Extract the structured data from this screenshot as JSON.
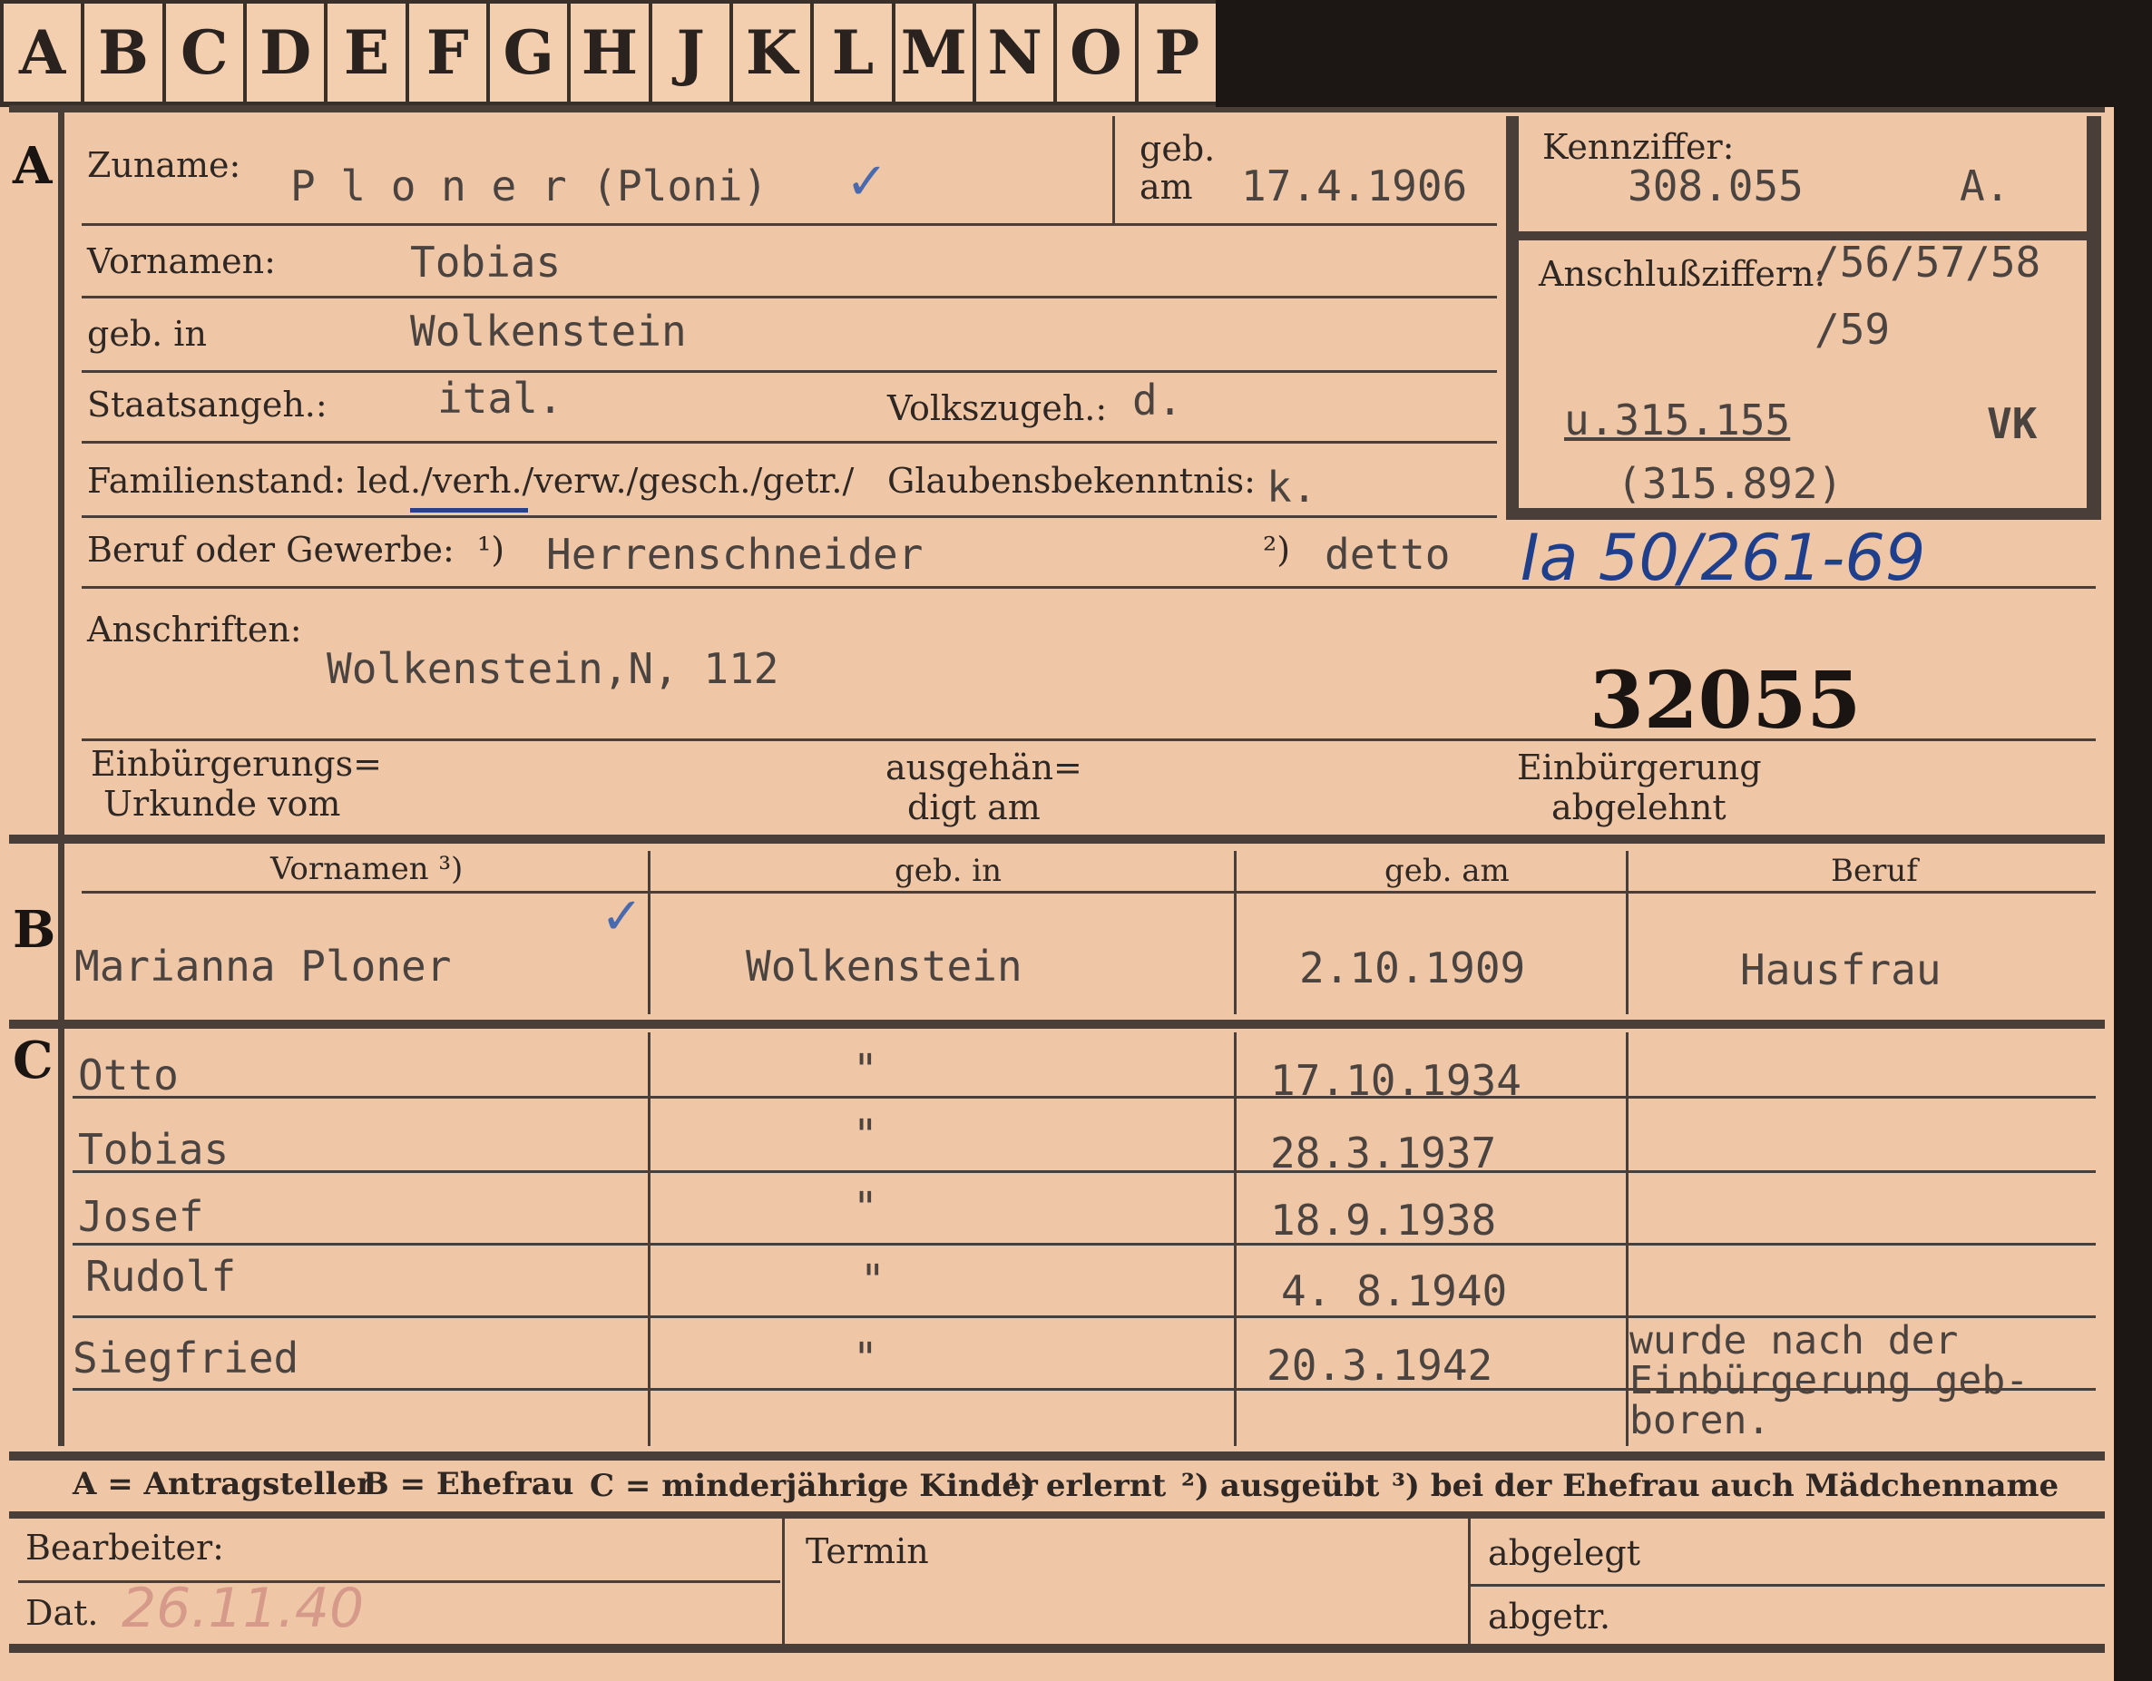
{
  "tabs": [
    "A",
    "B",
    "C",
    "D",
    "E",
    "F",
    "G",
    "H",
    "J",
    "K",
    "L",
    "M",
    "N",
    "O",
    "P"
  ],
  "sections": {
    "a": "A",
    "b": "B",
    "c": "C"
  },
  "form": {
    "zuname_label": "Zuname:",
    "zuname_value": "P l o n e r  (Ploni)",
    "geb_am_label1": "geb.",
    "geb_am_label2": "am",
    "geb_am_value": "17.4.1906",
    "kennziffer_label": "Kennziffer:",
    "kennziffer_value": "308.055",
    "kennziffer_suffix": "A.",
    "anschluss_label": "Anschlußziffern:",
    "anschluss_value1": "/56/57/58",
    "anschluss_value2": "/59",
    "u_value": "u.315.155",
    "vk": "VK",
    "u_value2": "(315.892)",
    "vornamen_label": "Vornamen:",
    "vornamen_value": "Tobias",
    "geb_in_label": "geb. in",
    "geb_in_value": "Wolkenstein",
    "staat_label": "Staatsangeh.:",
    "staat_value": "ital.",
    "volk_label": "Volkszugeh.:",
    "volk_value": "d.",
    "familien_label": "Familienstand: led./verh./verw./gesch./getr./",
    "glauben_label": "Glaubensbekenntnis:",
    "glauben_value": "k.",
    "beruf_label": "Beruf oder Gewerbe:",
    "beruf_note1": "¹)",
    "beruf_value": "Herrenschneider",
    "beruf_note2": "²)",
    "beruf_value2": "detto",
    "hand_ref": "Ia 50/261-69",
    "anschriften_label": "Anschriften:",
    "anschriften_value": "Wolkenstein,N, 112",
    "stamp_number": "32055",
    "einb_label1": "Einbürgerungs=",
    "einb_label2": "Urkunde vom",
    "ausg_label1": "ausgehän=",
    "ausg_label2": "digt am",
    "abgelehnt_label1": "Einbürgerung",
    "abgelehnt_label2": "abgelehnt"
  },
  "table": {
    "headers": [
      "Vornamen ³)",
      "geb. in",
      "geb. am",
      "Beruf"
    ],
    "spouse": {
      "name": "Marianna Ploner",
      "place": "Wolkenstein",
      "date": "2.10.1909",
      "job": "Hausfrau"
    },
    "children": [
      {
        "name": "Otto",
        "place": "\"",
        "date": "17.10.1934",
        "job": ""
      },
      {
        "name": "Tobias",
        "place": "\"",
        "date": "28.3.1937",
        "job": ""
      },
      {
        "name": "Josef",
        "place": "\"",
        "date": "18.9.1938",
        "job": ""
      },
      {
        "name": "Rudolf",
        "place": "\"",
        "date": "4. 8.1940",
        "job": ""
      },
      {
        "name": "Siegfried",
        "place": "\"",
        "date": "20.3.1942",
        "job": "wurde nach der Einbürgerung geb-boren."
      }
    ]
  },
  "legend": {
    "a": "A = Antragsteller",
    "b": "B = Ehefrau",
    "c": "C = minderjährige Kinder",
    "n1": "¹) erlernt",
    "n2": "²) ausgeübt",
    "n3": "³) bei der Ehefrau auch Mädchenname"
  },
  "footer": {
    "bearbeiter_label": "Bearbeiter:",
    "dat_label": "Dat.",
    "dat_value": "26.11.40",
    "termin_label": "Termin",
    "abgelegt_label": "abgelegt",
    "abgetr_label": "abgetr."
  }
}
